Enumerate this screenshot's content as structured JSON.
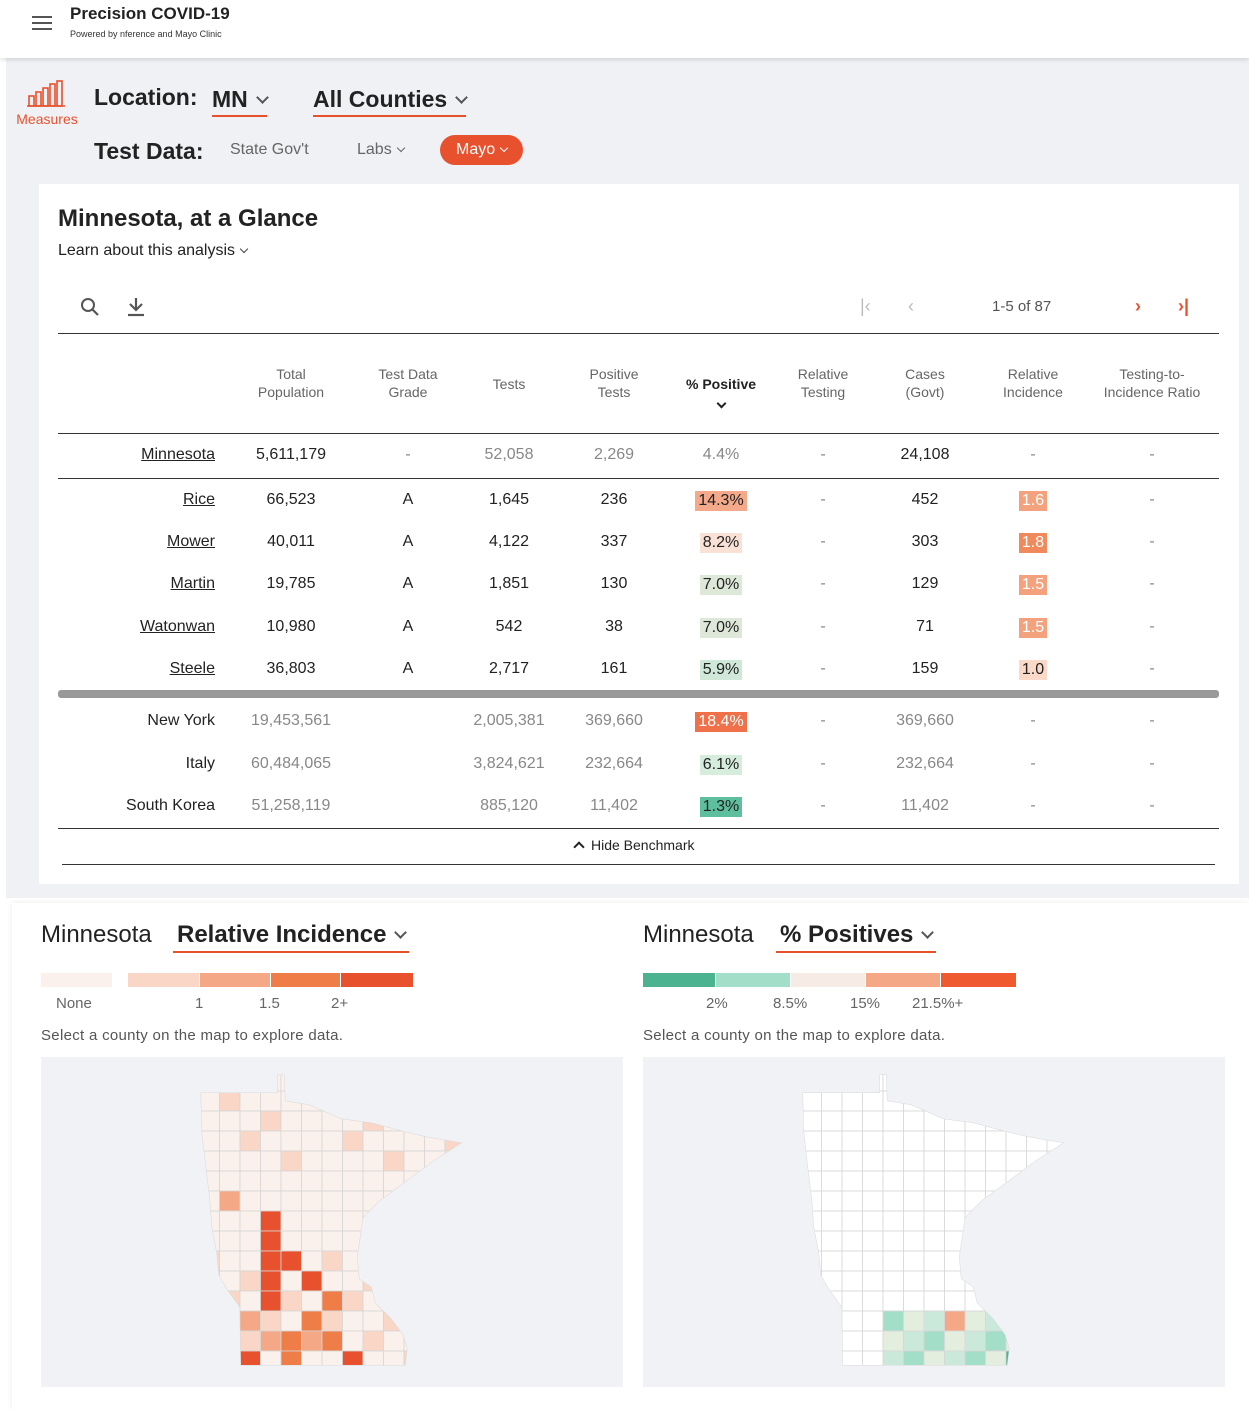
{
  "header": {
    "title": "Precision COVID-19",
    "subtitle": "Powered by nference and Mayo Clinic"
  },
  "controls": {
    "measures_label": "Measures",
    "location_label": "Location:",
    "location_value": "MN",
    "county_value": "All Counties",
    "test_data_label": "Test Data:",
    "test_options": [
      "State Gov't",
      "Labs",
      "Mayo"
    ],
    "selected_test": "Mayo"
  },
  "card": {
    "title": "Minnesota, at a Glance",
    "learn_link": "Learn about this analysis",
    "pager_text": "1-5 of 87",
    "hide_benchmark": "Hide Benchmark"
  },
  "table": {
    "headers": [
      [
        "Total",
        "Population"
      ],
      [
        "Test Data",
        "Grade"
      ],
      [
        "Tests"
      ],
      [
        "Positive",
        "Tests"
      ],
      [
        "% Positive"
      ],
      [
        "Relative",
        "Testing"
      ],
      [
        "Cases",
        "(Govt)"
      ],
      [
        "Relative",
        "Incidence"
      ],
      [
        "Testing-to-",
        "Incidence Ratio"
      ]
    ],
    "state_row": [
      "Minnesota",
      "5,611,179",
      "-",
      "52,058",
      "2,269",
      "4.4%",
      "-",
      "24,108",
      "-",
      "-"
    ],
    "county_rows": [
      [
        "Rice",
        "66,523",
        "A",
        "1,645",
        "236",
        "14.3%",
        "-",
        "452",
        "1.6",
        "-"
      ],
      [
        "Mower",
        "40,011",
        "A",
        "4,122",
        "337",
        "8.2%",
        "-",
        "303",
        "1.8",
        "-"
      ],
      [
        "Martin",
        "19,785",
        "A",
        "1,851",
        "130",
        "7.0%",
        "-",
        "129",
        "1.5",
        "-"
      ],
      [
        "Watonwan",
        "10,980",
        "A",
        "542",
        "38",
        "7.0%",
        "-",
        "71",
        "1.5",
        "-"
      ],
      [
        "Steele",
        "36,803",
        "A",
        "2,717",
        "161",
        "5.9%",
        "-",
        "159",
        "1.0",
        "-"
      ]
    ],
    "benchmark_rows": [
      [
        "New York",
        "19,453,561",
        "",
        "2,005,381",
        "369,660",
        "18.4%",
        "-",
        "369,660",
        "-",
        "-"
      ],
      [
        "Italy",
        "60,484,065",
        "",
        "3,824,621",
        "232,664",
        "6.1%",
        "-",
        "232,664",
        "-",
        "-"
      ],
      [
        "South Korea",
        "51,258,119",
        "",
        "885,120",
        "11,402",
        "1.3%",
        "-",
        "11,402",
        "-",
        "-"
      ]
    ],
    "pct_colors": [
      "#f4a98a",
      "#f9e1d6",
      "#dde8d8",
      "#dde8d8",
      "#cfe8d8"
    ],
    "incidence_colors": [
      "#f4a27e",
      "#f08a5c",
      "#f4a27e",
      "#f4a27e",
      "#fbd9c8"
    ],
    "bench_colors": [
      "#f0704a",
      "#d6ecdc",
      "#5ebf9e"
    ]
  },
  "map_left": {
    "title": "Minnesota",
    "measure": "Relative Incidence",
    "legend": [
      "None",
      "1",
      "1.5",
      "2+"
    ],
    "colors": [
      "#faf0ec",
      "#f9d6c6",
      "#f4a886",
      "#ee7d48",
      "#e8512d"
    ],
    "help": "Select a county on the map to explore data."
  },
  "map_right": {
    "title": "Minnesota",
    "measure": "% Positives",
    "legend": [
      "2%",
      "8.5%",
      "15%",
      "21.5%+"
    ],
    "colors": [
      "#4cb391",
      "#a3dec9",
      "#f7ebe6",
      "#f4a886",
      "#ef5a2f"
    ],
    "help": "Select a county on the map to explore data."
  }
}
